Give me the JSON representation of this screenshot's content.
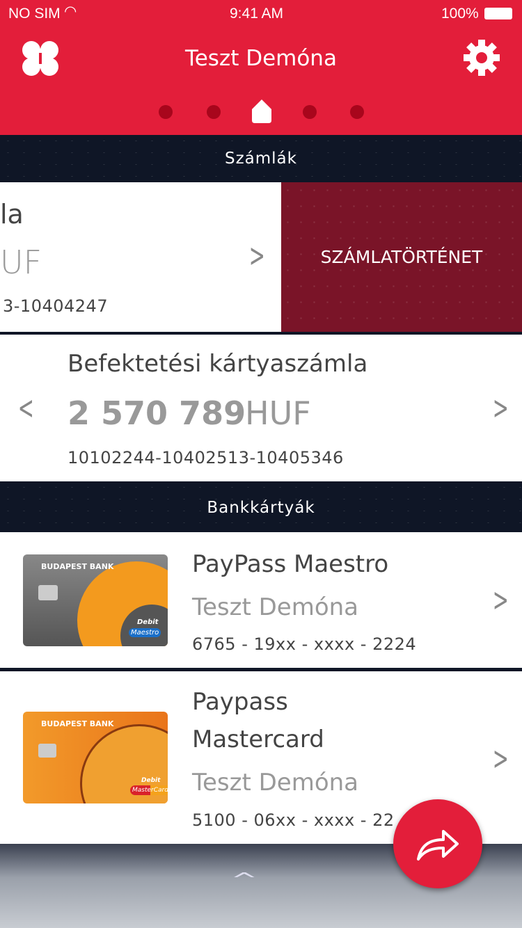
{
  "status": {
    "carrier": "NO SIM",
    "time": "9:41 AM",
    "battery": "100%"
  },
  "header": {
    "title": "Teszt Demóna",
    "logo_icon": "budapest-bank-logo",
    "settings_icon": "gear-icon",
    "accent": "#e31e3a"
  },
  "sections": {
    "accounts": "Számlák",
    "cards": "Bankkártyák"
  },
  "accounts": [
    {
      "name_partial": "la",
      "currency_partial": "UF",
      "number_partial": "3-10404247",
      "action": "SZÁMLATÖRTÉNET"
    },
    {
      "name": "Befektetési kártyaszámla",
      "amount": "2 570 789",
      "currency": "HUF",
      "number": "10102244-10402513-10405346"
    }
  ],
  "cards": [
    {
      "name": "PayPass Maestro",
      "holder": "Teszt Demóna",
      "number": "6765 - 19xx - xxxx - 2224",
      "bank": "BUDAPEST BANK",
      "type": "Debit",
      "brand": "Maestro"
    },
    {
      "name_line1": "Paypass",
      "name_line2": "Mastercard",
      "holder": "Teszt Demóna",
      "number": "5100 - 06xx - xxxx - 22",
      "bank": "BUDAPEST BANK",
      "type": "Debit",
      "brand": "MasterCard"
    }
  ]
}
